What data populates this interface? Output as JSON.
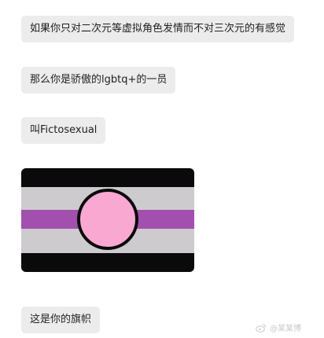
{
  "chat": {
    "messages": [
      {
        "text": "如果你只对二次元等虚拟角色发情而不对三次元的有感觉"
      },
      {
        "text": "那么你是骄傲的lgbtq+的一员"
      },
      {
        "text": "叫Fictosexual"
      },
      {
        "text": "这是你的旗帜"
      }
    ],
    "flag": {
      "image_kind": "fictosexual-pride-flag",
      "colors": {
        "black": "#0a0a0a",
        "gray": "#cdcbce",
        "purple": "#a24fae",
        "pink": "#f9a8d2"
      }
    }
  },
  "watermark": {
    "icon": "weibo-logo-icon",
    "text": "@某某博"
  }
}
